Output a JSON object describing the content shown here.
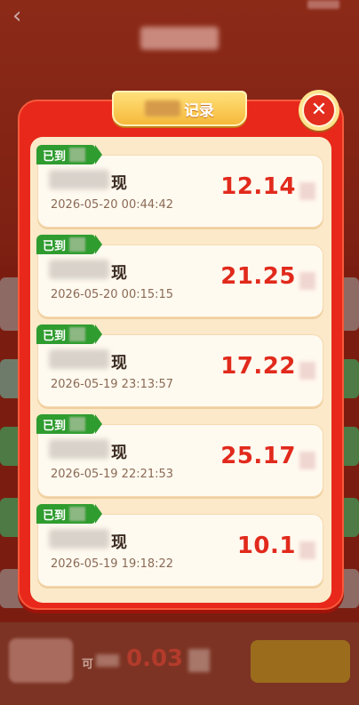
{
  "background": {
    "back_icon": "chevron-left-icon",
    "bottom": {
      "available_label": "可",
      "amount": "0.03"
    }
  },
  "modal": {
    "title": "记录",
    "close_icon": "close-icon",
    "records": [
      {
        "badge": "已到",
        "name_suffix": "现",
        "time": "2026-05-20 00:44:42",
        "amount": "12.14"
      },
      {
        "badge": "已到",
        "name_suffix": "现",
        "time": "2026-05-20 00:15:15",
        "amount": "21.25"
      },
      {
        "badge": "已到",
        "name_suffix": "现",
        "time": "2026-05-19 23:13:57",
        "amount": "17.22"
      },
      {
        "badge": "已到",
        "name_suffix": "现",
        "time": "2026-05-19 22:21:53",
        "amount": "25.17"
      },
      {
        "badge": "已到",
        "name_suffix": "现",
        "time": "2026-05-19 19:18:22",
        "amount": "10.1"
      }
    ]
  },
  "colors": {
    "modal_red": "#e8281a",
    "card_bg": "#fffaf0",
    "badge_green": "#2f9c2f",
    "amount_red": "#e12a1c",
    "ribbon_gold": "#f6b93b"
  }
}
